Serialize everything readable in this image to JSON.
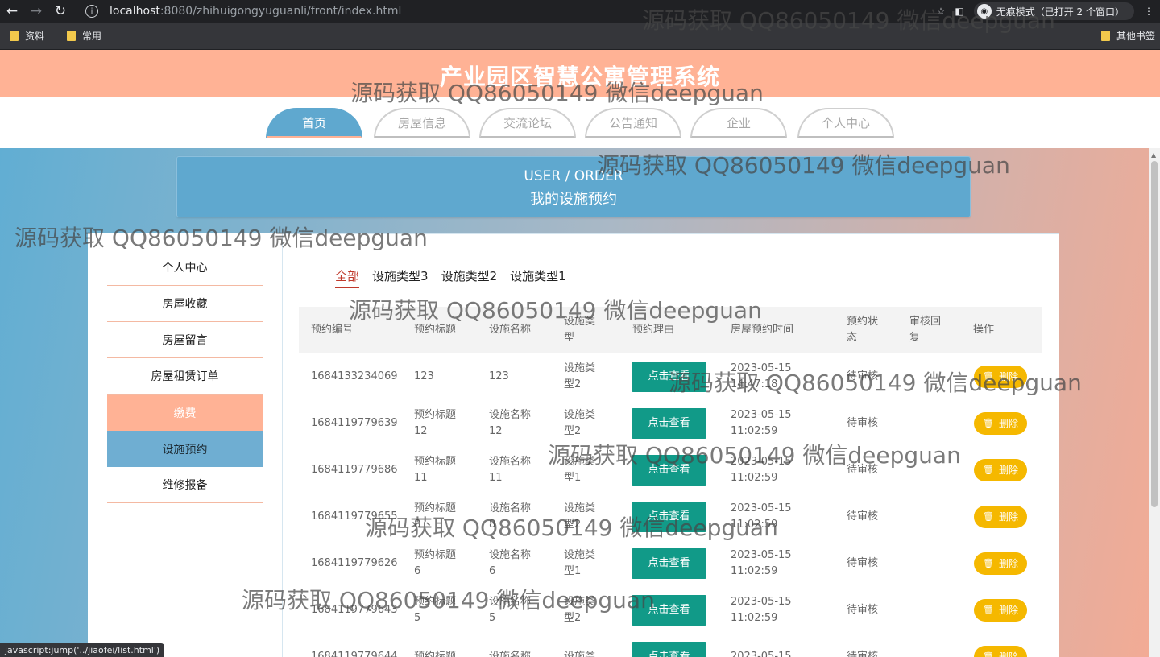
{
  "browser": {
    "url_host": "localhost",
    "url_path": ":8080/zhihuigongyuguanli/front/index.html",
    "incognito_label": "无痕模式（已打开 2 个窗口）",
    "bookmarks": [
      "资料",
      "常用"
    ],
    "other_bookmarks": "其他书签",
    "status_url": "javascript:jump('../jiaofei/list.html')"
  },
  "site": {
    "title": "产业园区智慧公寓管理系统",
    "nav": [
      "首页",
      "房屋信息",
      "交流论坛",
      "公告通知",
      "企业",
      "个人中心"
    ],
    "active_nav_index": 0
  },
  "banner": {
    "en": "USER / ORDER",
    "cn": "我的设施预约"
  },
  "sidebar": {
    "items": [
      "个人中心",
      "房屋收藏",
      "房屋留言",
      "房屋租赁订单",
      "缴费",
      "设施预约",
      "维修报备"
    ]
  },
  "filters": [
    "全部",
    "设施类型3",
    "设施类型2",
    "设施类型1"
  ],
  "table": {
    "headers": [
      "预约编号",
      "预约标题",
      "设施名称",
      "设施类\n型",
      "预约理由",
      "房屋预约时间",
      "预约状\n态",
      "审核回\n复",
      "操作"
    ],
    "view_label": "点击查看",
    "delete_label": "删除",
    "rows": [
      {
        "id": "1684133234069",
        "title": "123",
        "facility": "123",
        "type": "设施类\n型2",
        "time": "2023-05-15\n14:47:18",
        "status": "待审核"
      },
      {
        "id": "1684119779639",
        "title": "预约标题\n12",
        "facility": "设施名称\n12",
        "type": "设施类\n型2",
        "time": "2023-05-15\n11:02:59",
        "status": "待审核"
      },
      {
        "id": "1684119779686",
        "title": "预约标题\n11",
        "facility": "设施名称\n11",
        "type": "设施类\n型1",
        "time": "2023-05-15\n11:02:59",
        "status": "待审核"
      },
      {
        "id": "1684119779655",
        "title": "预约标题\n8",
        "facility": "设施名称\n8",
        "type": "设施类\n型2",
        "time": "2023-05-15\n11:02:59",
        "status": "待审核"
      },
      {
        "id": "1684119779626",
        "title": "预约标题\n6",
        "facility": "设施名称\n6",
        "type": "设施类\n型1",
        "time": "2023-05-15\n11:02:59",
        "status": "待审核"
      },
      {
        "id": "1684119779643",
        "title": "预约标题\n5",
        "facility": "设施名称\n5",
        "type": "设施类\n型2",
        "time": "2023-05-15\n11:02:59",
        "status": "待审核"
      },
      {
        "id": "1684119779644",
        "title": "预约标题",
        "facility": "设施名称",
        "type": "设施类",
        "time": "2023-05-15",
        "status": "待审核"
      }
    ]
  },
  "watermark": "源码获取 QQ86050149 微信deepguan"
}
